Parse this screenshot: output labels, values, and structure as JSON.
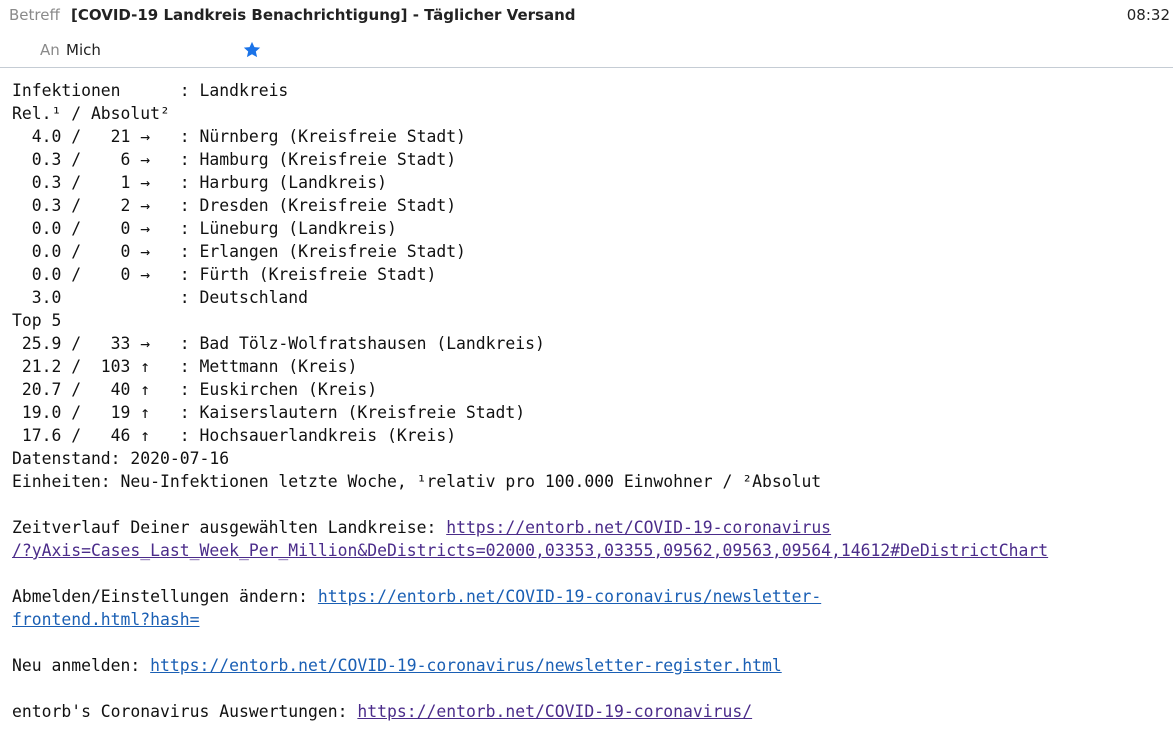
{
  "header": {
    "subject_label": "Betreff",
    "subject": "[COVID-19 Landkreis Benachrichtigung] - Täglicher Versand",
    "time": "08:32",
    "to_label": "An",
    "to_value": "Mich",
    "star_icon": "star-icon",
    "star_color": "#1a73e8"
  },
  "body": {
    "header_line1": "Infektionen      : Landkreis",
    "header_line2": "Rel.¹ / Absolut²",
    "rows": [
      "  4.0 /   21 →   : Nürnberg (Kreisfreie Stadt)",
      "  0.3 /    6 →   : Hamburg (Kreisfreie Stadt)",
      "  0.3 /    1 →   : Harburg (Landkreis)",
      "  0.3 /    2 →   : Dresden (Kreisfreie Stadt)",
      "  0.0 /    0 →   : Lüneburg (Landkreis)",
      "  0.0 /    0 →   : Erlangen (Kreisfreie Stadt)",
      "  0.0 /    0 →   : Fürth (Kreisfreie Stadt)",
      "  3.0            : Deutschland"
    ],
    "top5_label": "Top 5",
    "top5_rows": [
      " 25.9 /   33 →   : Bad Tölz-Wolfratshausen (Landkreis)",
      " 21.2 /  103 ↑   : Mettmann (Kreis)",
      " 20.7 /   40 ↑   : Euskirchen (Kreis)",
      " 19.0 /   19 ↑   : Kaiserslautern (Kreisfreie Stadt)",
      " 17.6 /   46 ↑   : Hochsauerlandkreis (Kreis)"
    ],
    "datenstand": "Datenstand: 2020-07-16",
    "einheiten": "Einheiten: Neu-Infektionen letzte Woche, ¹relativ pro 100.000 Einwohner / ²Absolut",
    "zeitverlauf_label": "Zeitverlauf Deiner ausgewählten Landkreise: ",
    "zeitverlauf_link_1": "https://entorb.net/COVID-19-coronavirus",
    "zeitverlauf_link_2": "/?yAxis=Cases_Last_Week_Per_Million&DeDistricts=02000,03353,03355,09562,09563,09564,14612#DeDistrictChart",
    "abmelden_label": "Abmelden/Einstellungen ändern: ",
    "abmelden_link_1": "https://entorb.net/COVID-19-coronavirus/newsletter-",
    "abmelden_link_2": "frontend.html?hash=",
    "neu_label": "Neu anmelden: ",
    "neu_link": "https://entorb.net/COVID-19-coronavirus/newsletter-register.html",
    "entorb_label": "entorb's Coronavirus Auswertungen: ",
    "entorb_link": "https://entorb.net/COVID-19-coronavirus/"
  }
}
